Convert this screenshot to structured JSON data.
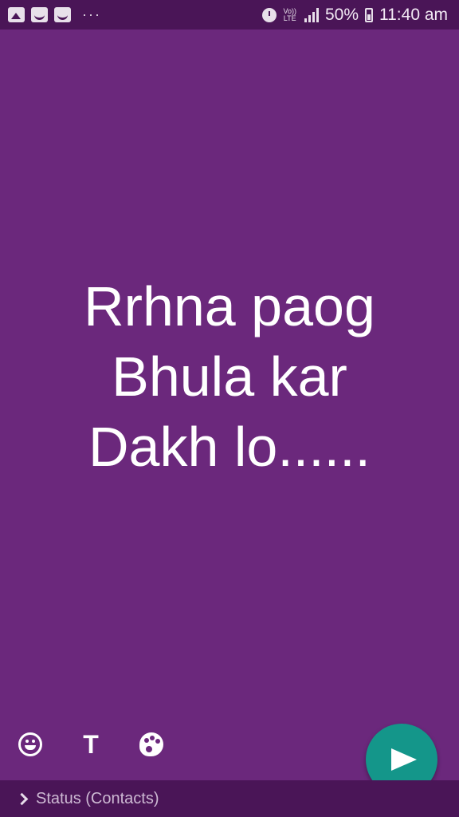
{
  "status_bar": {
    "more_indicator": "···",
    "volte_top": "Vo))",
    "volte_bottom": "LTE",
    "battery": "50%",
    "time": "11:40 am",
    "icons": [
      "gallery-notification-icon",
      "emoji-notification-icon",
      "emoji-notification-icon",
      "alarm-icon",
      "volte-icon",
      "signal-icon",
      "battery-icon"
    ]
  },
  "status": {
    "lines": [
      "Rrhna paog",
      "Bhula kar",
      "Dakh lo......"
    ],
    "text_color": "#ffffff",
    "background_color": "#6b287c"
  },
  "tools": {
    "emoji_icon": "emoji-icon",
    "text_label": "T",
    "palette_icon": "palette-icon"
  },
  "send": {
    "icon": "send-icon",
    "color": "#14968a"
  },
  "footer": {
    "audience_label": "Status (Contacts)"
  }
}
